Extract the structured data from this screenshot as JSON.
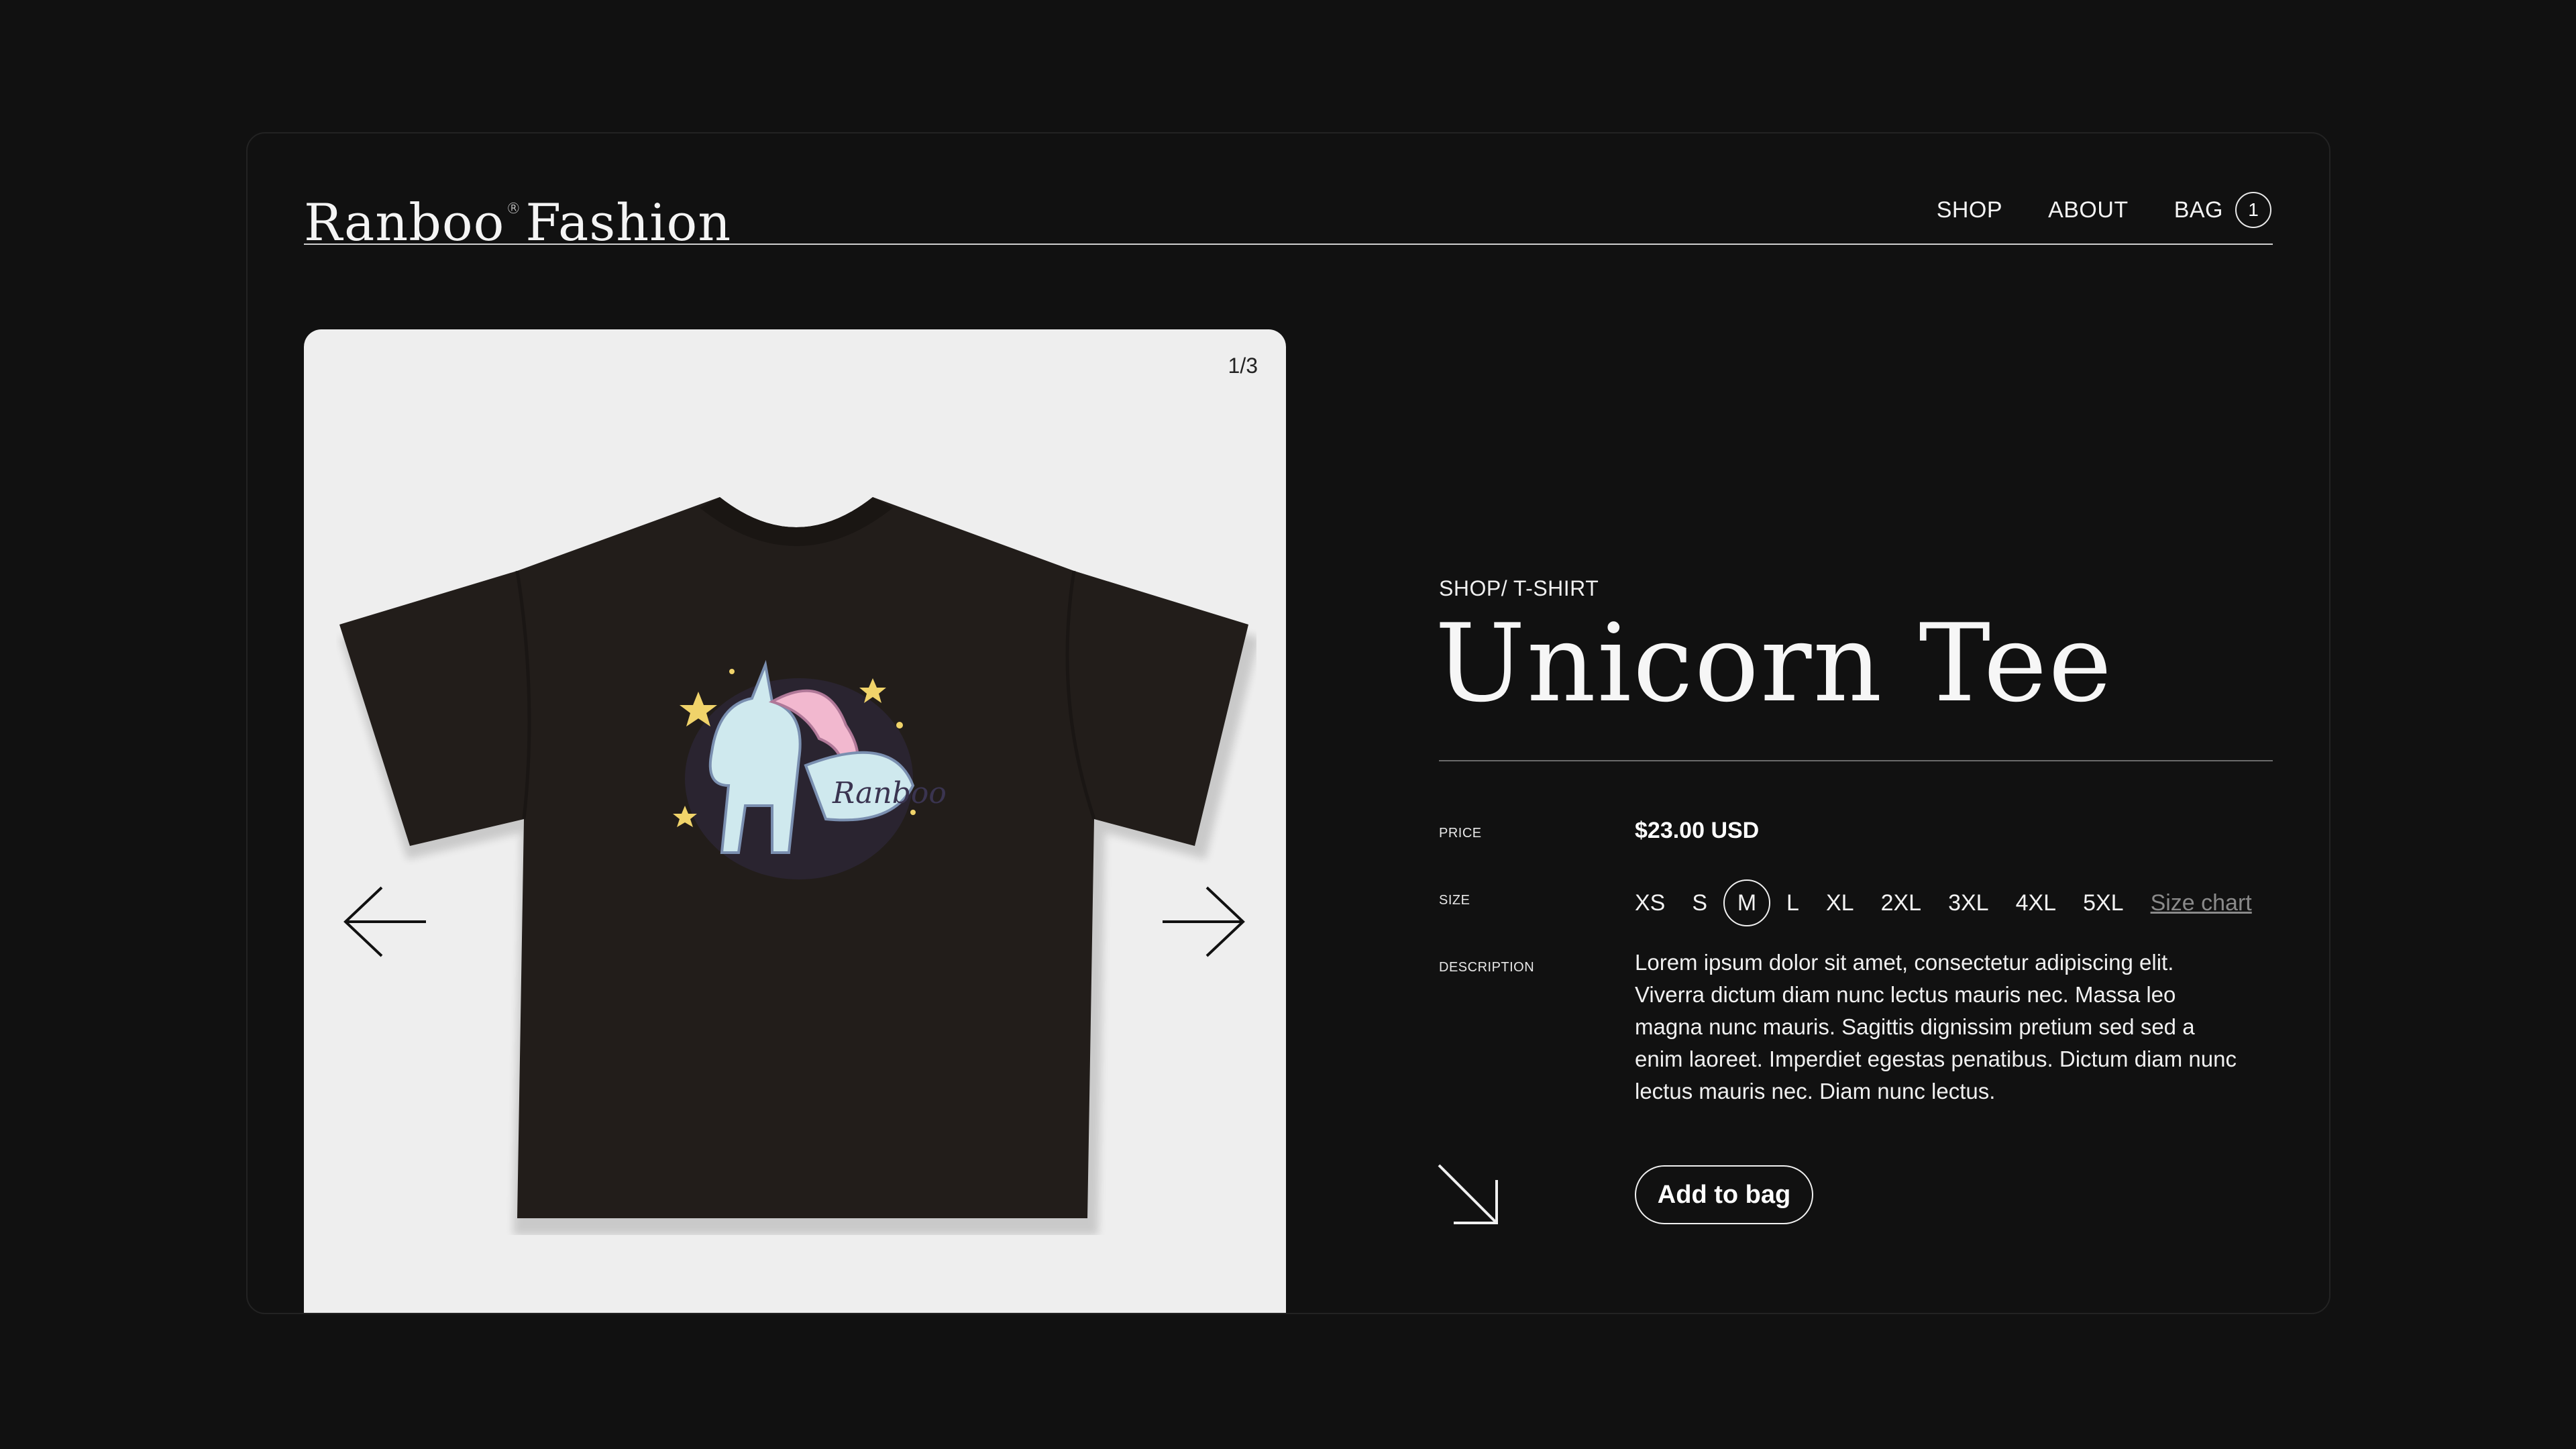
{
  "header": {
    "logo_name": "Ranboo",
    "logo_mark": "®",
    "logo_suffix": "Fashion",
    "nav": {
      "shop": "SHOP",
      "about": "ABOUT",
      "bag": "BAG",
      "bag_count": "1"
    }
  },
  "gallery": {
    "counter": "1/3",
    "prev_icon": "arrow-left-icon",
    "next_icon": "arrow-right-icon",
    "print_text": "Ranboo"
  },
  "product": {
    "breadcrumb": "SHOP/ T-SHIRT",
    "title": "Unicorn Tee",
    "price_label": "PRICE",
    "price": "$23.00 USD",
    "size_label": "SIZE",
    "sizes": [
      "XS",
      "S",
      "M",
      "L",
      "XL",
      "2XL",
      "3XL",
      "4XL",
      "5XL"
    ],
    "selected_size": "M",
    "size_chart": "Size chart",
    "description_label": "DESCRIPTION",
    "description": "Lorem ipsum dolor sit amet, consectetur adipiscing elit. Viverra dictum diam nunc lectus mauris nec. Massa leo magna nunc mauris. Sagittis dignissim pretium sed sed a enim laoreet. Imperdiet egestas penatibus. Dictum diam nunc lectus mauris nec. Diam nunc lectus.",
    "add_to_bag": "Add to bag",
    "cta_icon": "arrow-down-right-icon"
  },
  "colors": {
    "background": "#111111",
    "card": "#eeeeee",
    "text": "#ffffff",
    "muted": "#8a8a8a"
  }
}
